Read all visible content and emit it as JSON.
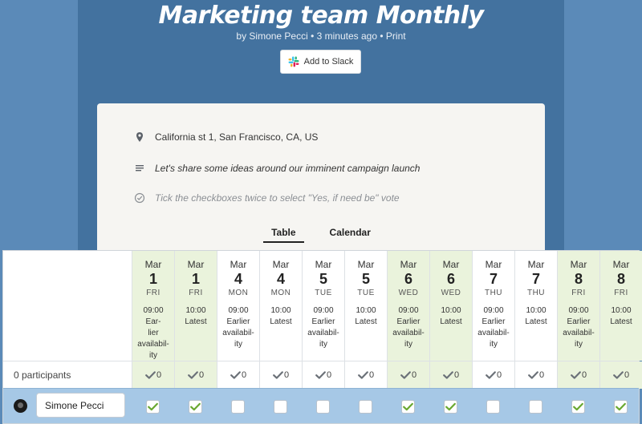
{
  "page": {
    "title": "Marketing team Monthly",
    "byline": {
      "author": "by Simone Pecci",
      "sep1": " • ",
      "time": "3 minutes ago",
      "sep2": " • ",
      "print": "Print"
    },
    "slack_button": "Add to Slack"
  },
  "card": {
    "location": "California st 1, San Francisco, CA, US",
    "description": "Let's share some ideas around our imminent campaign launch",
    "hint": "Tick the checkboxes twice to select \"Yes, if need be\" vote",
    "tabs": [
      {
        "label": "Table",
        "active": true
      },
      {
        "label": "Calendar",
        "active": false
      }
    ]
  },
  "poll": {
    "participants_label": "0 participants",
    "options": [
      {
        "month": "Mar",
        "day": "1",
        "dow": "FRI",
        "time": "09:00 Ear-lier availability",
        "time_lines": [
          "09:00 Ear-",
          "lier",
          "availabil-",
          "ity"
        ],
        "count": "0",
        "yes": true
      },
      {
        "month": "Mar",
        "day": "1",
        "dow": "FRI",
        "time_lines": [
          "10:00",
          "Latest"
        ],
        "count": "0",
        "yes": true
      },
      {
        "month": "Mar",
        "day": "4",
        "dow": "MON",
        "time_lines": [
          "09:00",
          "Earlier",
          "availabil-",
          "ity"
        ],
        "count": "0",
        "yes": false
      },
      {
        "month": "Mar",
        "day": "4",
        "dow": "MON",
        "time_lines": [
          "10:00",
          "Latest"
        ],
        "count": "0",
        "yes": false
      },
      {
        "month": "Mar",
        "day": "5",
        "dow": "TUE",
        "time_lines": [
          "09:00",
          "Earlier",
          "availabil-",
          "ity"
        ],
        "count": "0",
        "yes": false
      },
      {
        "month": "Mar",
        "day": "5",
        "dow": "TUE",
        "time_lines": [
          "10:00",
          "Latest"
        ],
        "count": "0",
        "yes": false
      },
      {
        "month": "Mar",
        "day": "6",
        "dow": "WED",
        "time_lines": [
          "09:00",
          "Earlier",
          "availabil-",
          "ity"
        ],
        "count": "0",
        "yes": true
      },
      {
        "month": "Mar",
        "day": "6",
        "dow": "WED",
        "time_lines": [
          "10:00",
          "Latest"
        ],
        "count": "0",
        "yes": true
      },
      {
        "month": "Mar",
        "day": "7",
        "dow": "THU",
        "time_lines": [
          "09:00",
          "Earlier",
          "availabil-",
          "ity"
        ],
        "count": "0",
        "yes": false
      },
      {
        "month": "Mar",
        "day": "7",
        "dow": "THU",
        "time_lines": [
          "10:00",
          "Latest"
        ],
        "count": "0",
        "yes": false
      },
      {
        "month": "Mar",
        "day": "8",
        "dow": "FRI",
        "time_lines": [
          "09:00",
          "Earlier",
          "availabil-",
          "ity"
        ],
        "count": "0",
        "yes": true
      },
      {
        "month": "Mar",
        "day": "8",
        "dow": "FRI",
        "time_lines": [
          "10:00",
          "Latest"
        ],
        "count": "0",
        "yes": true
      }
    ],
    "participant": {
      "name": "Simone Pecci",
      "votes": [
        true,
        true,
        false,
        false,
        false,
        false,
        true,
        true,
        false,
        false,
        true,
        true
      ]
    }
  },
  "colors": {
    "background": "#4a7cab",
    "yes_column": "#eaf3dc",
    "participant_row": "#a6c8e6",
    "check_green": "#6aa830"
  }
}
